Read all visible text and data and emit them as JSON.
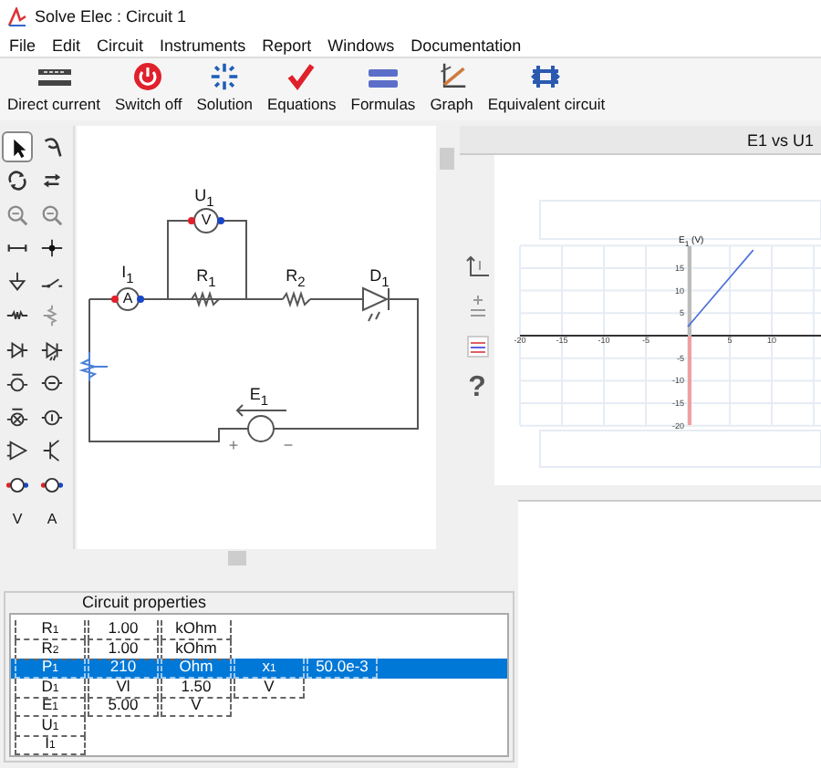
{
  "window": {
    "title": "Solve Elec : Circuit 1"
  },
  "menu": [
    "File",
    "Edit",
    "Circuit",
    "Instruments",
    "Report",
    "Windows",
    "Documentation"
  ],
  "toolbar": [
    {
      "kind": "dc",
      "label": "Direct current"
    },
    {
      "kind": "power",
      "label": "Switch off"
    },
    {
      "kind": "solution",
      "label": "Solution"
    },
    {
      "kind": "equations",
      "label": "Equations"
    },
    {
      "kind": "formulas",
      "label": "Formulas"
    },
    {
      "kind": "graph",
      "label": "Graph"
    },
    {
      "kind": "equivalent",
      "label": "Equivalent circuit"
    }
  ],
  "tools": [
    {
      "selected": true
    },
    {
      "selected": false
    },
    {
      "selected": false
    },
    {
      "selected": false
    },
    {
      "selected": false
    },
    {
      "selected": false
    },
    {
      "selected": false
    },
    {
      "selected": false
    },
    {
      "selected": false
    },
    {
      "selected": false
    },
    {
      "selected": false
    },
    {
      "selected": false
    },
    {
      "selected": false
    },
    {
      "selected": false
    },
    {
      "selected": false
    },
    {
      "selected": false
    },
    {
      "selected": false
    },
    {
      "selected": false
    },
    {
      "selected": false
    },
    {
      "selected": false
    },
    {
      "selected": false
    },
    {
      "selected": false
    },
    {
      "selected": false,
      "label": "V"
    },
    {
      "selected": false,
      "label": "A"
    }
  ],
  "circuit": {
    "labels": [
      "U$_{1}$",
      "I$_{1}$",
      "R$_{1}$",
      "R$_{2}$",
      "D$_{1}$",
      "E$_{1}$"
    ],
    "meters": [
      "A",
      "V"
    ],
    "plus": "+",
    "minus": "−"
  },
  "graph_panel": {
    "title": "E1 vs U1",
    "help": "?",
    "chart_data": {
      "type": "line",
      "ylabel": "E$_{1}$ (V)",
      "x": [
        0,
        7.8
      ],
      "series": [
        {
          "color": "#4a6fd8",
          "values": [
            2,
            19
          ]
        }
      ],
      "xlim": [
        -20,
        15
      ],
      "ylim": [
        -20,
        20
      ],
      "grid": true,
      "xticks": [
        -20,
        -15,
        -10,
        -5,
        5,
        10
      ],
      "yticks": [
        -20,
        -15,
        -10,
        -5,
        5,
        10,
        15
      ]
    }
  },
  "properties": {
    "title": "Circuit properties",
    "rows": [
      {
        "selected": false,
        "cells": [
          "R$_{1}$",
          "1.00",
          "kOhm"
        ]
      },
      {
        "selected": false,
        "cells": [
          "R$_{2}$",
          "1.00",
          "kOhm"
        ]
      },
      {
        "selected": true,
        "cells": [
          "P$_{1}$",
          "210",
          "Ohm",
          "x$_{1}$",
          "50.0e-3"
        ]
      },
      {
        "selected": false,
        "cells": [
          "D$_{1}$",
          "Vl",
          "1.50",
          "V"
        ]
      },
      {
        "selected": false,
        "cells": [
          "E$_{1}$",
          "5.00",
          "V"
        ]
      },
      {
        "selected": false,
        "cells": [
          "U$_{1}$"
        ]
      },
      {
        "selected": false,
        "cells": [
          "I$_{1}$"
        ]
      }
    ]
  }
}
